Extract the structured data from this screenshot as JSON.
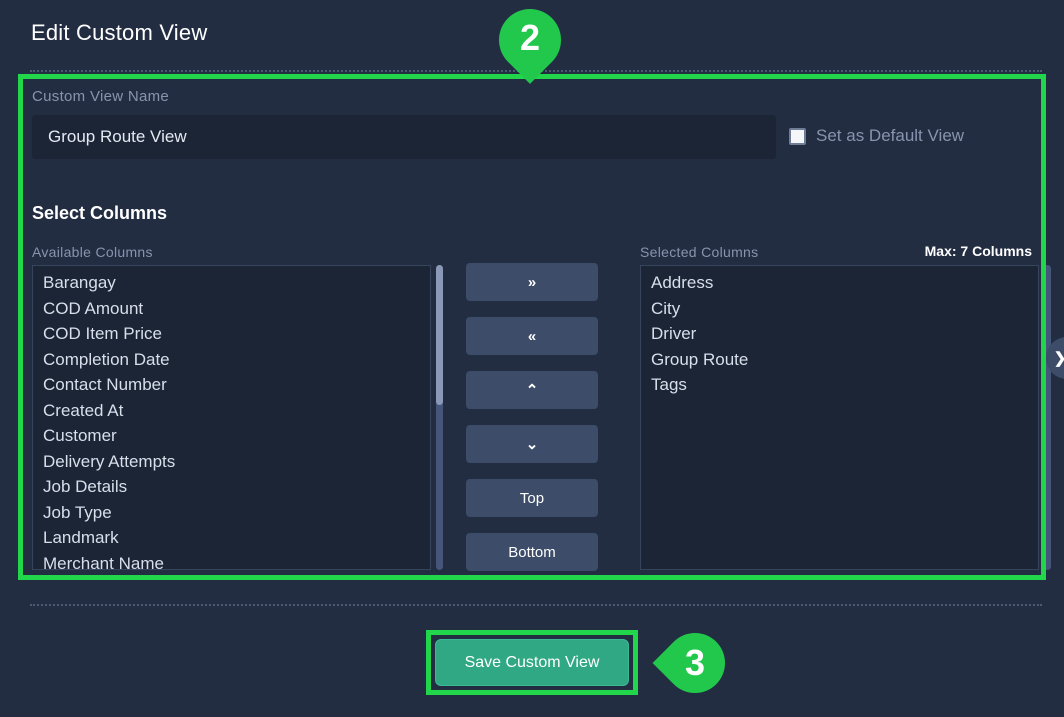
{
  "page": {
    "title": "Edit Custom View",
    "background_color": "#232d42",
    "highlight_color": "#22d64c",
    "accent_color": "#31a884"
  },
  "form": {
    "name_field": {
      "label": "Custom View Name",
      "value": "Group Route View",
      "placeholder": "Custom View Name"
    },
    "default_view": {
      "label": "Set as Default View",
      "checked": false
    }
  },
  "columns_section": {
    "heading": "Select Columns",
    "available_label": "Available Columns",
    "selected_label": "Selected Columns",
    "max_note": "Max: 7 Columns",
    "available": [
      "Barangay",
      "COD Amount",
      "COD Item Price",
      "Completion Date",
      "Contact Number",
      "Created At",
      "Customer",
      "Delivery Attempts",
      "Job Details",
      "Job Type",
      "Landmark",
      "Merchant Name"
    ],
    "selected": [
      "Address",
      "City",
      "Driver",
      "Group Route",
      "Tags"
    ],
    "transfer_buttons": [
      {
        "label": "»",
        "name": "move-right-button",
        "icon": "double-chevron-right-icon"
      },
      {
        "label": "«",
        "name": "move-left-button",
        "icon": "double-chevron-left-icon"
      },
      {
        "label": "⌃",
        "name": "move-up-button",
        "icon": "chevron-up-icon"
      },
      {
        "label": "⌄",
        "name": "move-down-button",
        "icon": "chevron-down-icon"
      },
      {
        "label": "Top",
        "name": "move-to-top-button",
        "icon": ""
      },
      {
        "label": "Bottom",
        "name": "move-to-bottom-button",
        "icon": ""
      }
    ]
  },
  "footer": {
    "save_label": "Save Custom View"
  },
  "edge_toggle": {
    "icon": "chevron-right-icon",
    "glyph": "❯"
  },
  "callouts": [
    {
      "number": "2",
      "target": "custom-view-form"
    },
    {
      "number": "3",
      "target": "save-custom-view-button"
    }
  ]
}
